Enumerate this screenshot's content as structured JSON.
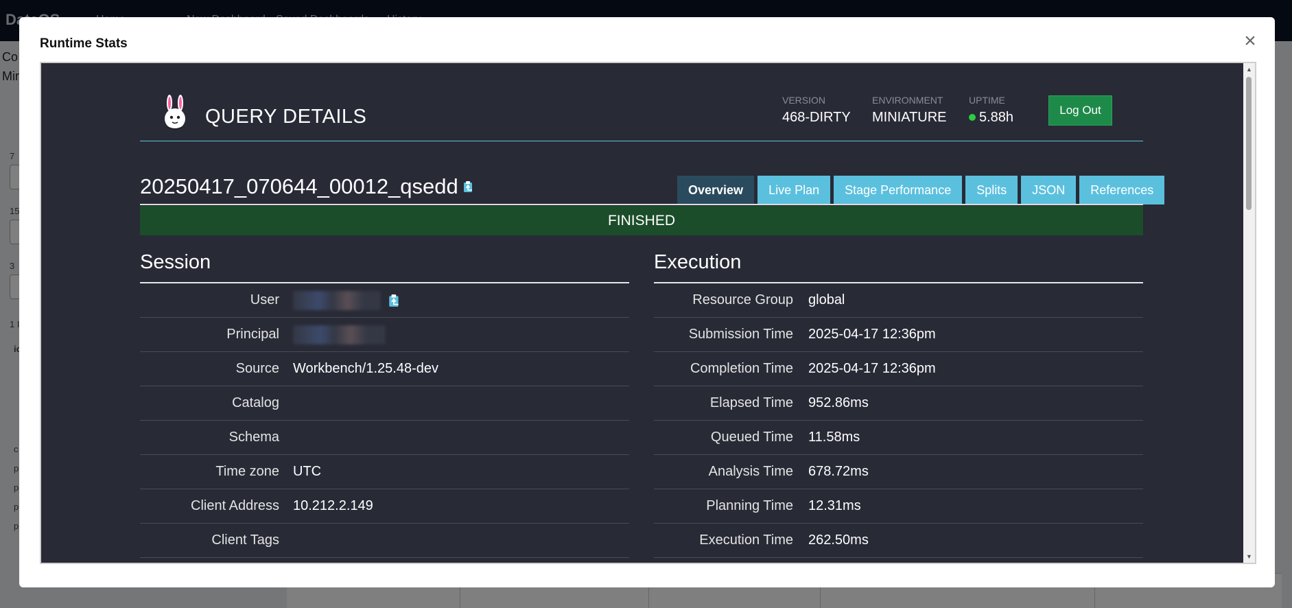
{
  "background": {
    "brand": "DataOS",
    "nav_items": [
      "Home",
      "New Dashboard",
      "Saved Dashboards",
      "History"
    ],
    "left_texts": [
      "Co",
      "Min"
    ],
    "row_numbers": [
      "7",
      "15",
      "3"
    ],
    "results_label": "1 I",
    "link_label": "ic",
    "list_letters": [
      "c",
      "p",
      "p",
      "p",
      "p"
    ]
  },
  "modal": {
    "title": "Runtime Stats",
    "close_label": "×"
  },
  "header": {
    "app_title": "QUERY DETAILS",
    "version_label": "VERSION",
    "version_value": "468-DIRTY",
    "environment_label": "ENVIRONMENT",
    "environment_value": "MINIATURE",
    "uptime_label": "UPTIME",
    "uptime_value": "5.88h",
    "logout_label": "Log Out"
  },
  "query": {
    "id": "20250417_070644_00012_qsedd",
    "status": "FINISHED",
    "tabs": [
      {
        "label": "Overview",
        "active": true
      },
      {
        "label": "Live Plan",
        "active": false
      },
      {
        "label": "Stage Performance",
        "active": false
      },
      {
        "label": "Splits",
        "active": false
      },
      {
        "label": "JSON",
        "active": false
      },
      {
        "label": "References",
        "active": false
      }
    ]
  },
  "session": {
    "title": "Session",
    "rows": [
      {
        "label": "User",
        "value": ""
      },
      {
        "label": "Principal",
        "value": ""
      },
      {
        "label": "Source",
        "value": "Workbench/1.25.48-dev"
      },
      {
        "label": "Catalog",
        "value": ""
      },
      {
        "label": "Schema",
        "value": ""
      },
      {
        "label": "Time zone",
        "value": "UTC"
      },
      {
        "label": "Client Address",
        "value": "10.212.2.149"
      },
      {
        "label": "Client Tags",
        "value": ""
      }
    ]
  },
  "execution": {
    "title": "Execution",
    "rows": [
      {
        "label": "Resource Group",
        "value": "global"
      },
      {
        "label": "Submission Time",
        "value": "2025-04-17 12:36pm"
      },
      {
        "label": "Completion Time",
        "value": "2025-04-17 12:36pm"
      },
      {
        "label": "Elapsed Time",
        "value": "952.86ms"
      },
      {
        "label": "Queued Time",
        "value": "11.58ms"
      },
      {
        "label": "Analysis Time",
        "value": "678.72ms"
      },
      {
        "label": "Planning Time",
        "value": "12.31ms"
      },
      {
        "label": "Execution Time",
        "value": "262.50ms"
      }
    ]
  },
  "colors": {
    "panel_bg": "#282a36",
    "accent": "#5bc0de",
    "status_bg": "#1b4d2a",
    "logout_bg": "#1e8a4a"
  }
}
